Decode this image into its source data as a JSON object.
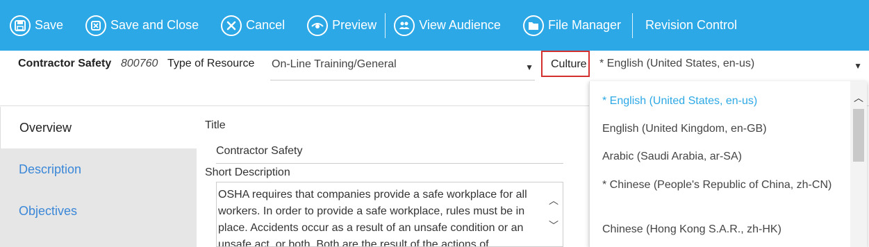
{
  "toolbar": {
    "save": "Save",
    "save_close": "Save and Close",
    "cancel": "Cancel",
    "preview": "Preview",
    "view_audience": "View Audience",
    "file_manager": "File Manager",
    "revision_control": "Revision Control"
  },
  "header": {
    "resource_name": "Contractor Safety",
    "resource_id": "800760",
    "type_label": "Type of Resource",
    "type_value": "On-Line Training/General",
    "culture_label": "Culture",
    "culture_value": "* English (United States, en-us)"
  },
  "tabs": [
    "Overview",
    "Description",
    "Objectives"
  ],
  "form": {
    "title_label": "Title",
    "title_value": "Contractor Safety",
    "short_desc_label": "Short Description",
    "short_desc_value": "OSHA requires that companies provide a safe workplace for all workers. In order to provide a safe workplace, rules must be in place. Accidents occur as a result of an unsafe condition or an unsafe act, or both. Both are the result of the actions of"
  },
  "culture_options": [
    "* English (United States, en-us)",
    "English (United Kingdom, en-GB)",
    "Arabic (Saudi Arabia, ar-SA)",
    "* Chinese (People's Republic of China, zh-CN)",
    "Chinese (Hong Kong S.A.R., zh-HK)"
  ],
  "colors": {
    "accent": "#2ca8e6",
    "link": "#3a87d8",
    "highlight_border": "#d32f2f"
  }
}
